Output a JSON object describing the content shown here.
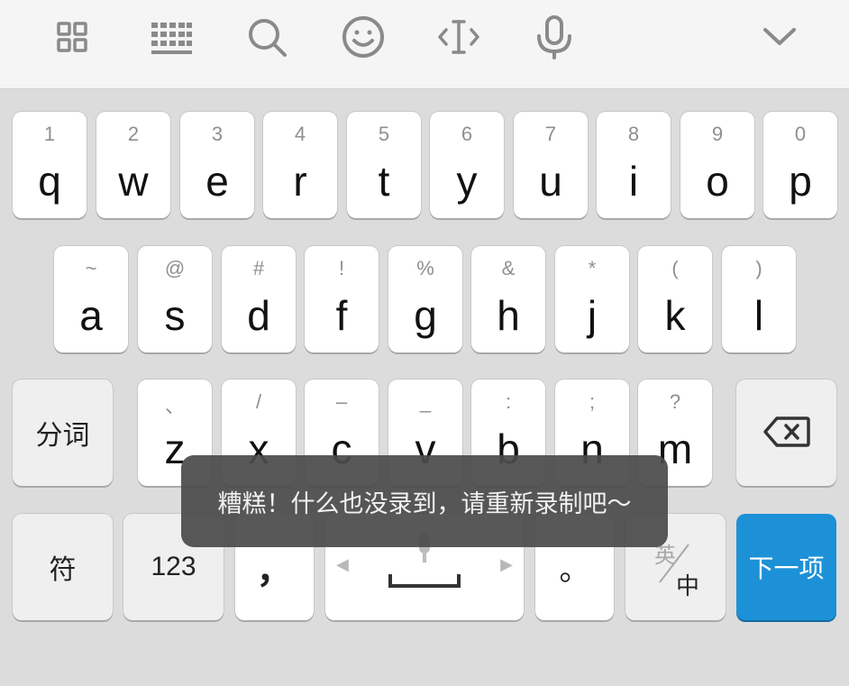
{
  "toolbar": {
    "icons": [
      "grid-icon",
      "keyboard-icon",
      "search-icon",
      "smiley-icon",
      "cursor-icon",
      "microphone-icon",
      "chevron-down-icon"
    ]
  },
  "rows": {
    "row1": [
      {
        "hint": "1",
        "char": "q"
      },
      {
        "hint": "2",
        "char": "w"
      },
      {
        "hint": "3",
        "char": "e"
      },
      {
        "hint": "4",
        "char": "r"
      },
      {
        "hint": "5",
        "char": "t"
      },
      {
        "hint": "6",
        "char": "y"
      },
      {
        "hint": "7",
        "char": "u"
      },
      {
        "hint": "8",
        "char": "i"
      },
      {
        "hint": "9",
        "char": "o"
      },
      {
        "hint": "0",
        "char": "p"
      }
    ],
    "row2": [
      {
        "hint": "~",
        "char": "a"
      },
      {
        "hint": "@",
        "char": "s"
      },
      {
        "hint": "#",
        "char": "d"
      },
      {
        "hint": "!",
        "char": "f"
      },
      {
        "hint": "%",
        "char": "g"
      },
      {
        "hint": "&",
        "char": "h"
      },
      {
        "hint": "*",
        "char": "j"
      },
      {
        "hint": "(",
        "char": "k"
      },
      {
        "hint": ")",
        "char": "l"
      }
    ],
    "row3": [
      {
        "hint": "、",
        "char": "z"
      },
      {
        "hint": "/",
        "char": "x"
      },
      {
        "hint": "–",
        "char": "c"
      },
      {
        "hint": "_",
        "char": "v"
      },
      {
        "hint": ":",
        "char": "b"
      },
      {
        "hint": ";",
        "char": "n"
      },
      {
        "hint": "?",
        "char": "m"
      }
    ]
  },
  "keys": {
    "segment": "分词",
    "symbols": "符",
    "numbers": "123",
    "comma": "，",
    "period": "。",
    "lang_top": "英",
    "lang_bottom": "中",
    "enter": "下一项"
  },
  "toast": {
    "message": "糟糕！什么也没录到，请重新录制吧～"
  },
  "colors": {
    "accent": "#1d91d7",
    "background": "#dcdcdc",
    "toolbar": "#f5f5f5"
  }
}
